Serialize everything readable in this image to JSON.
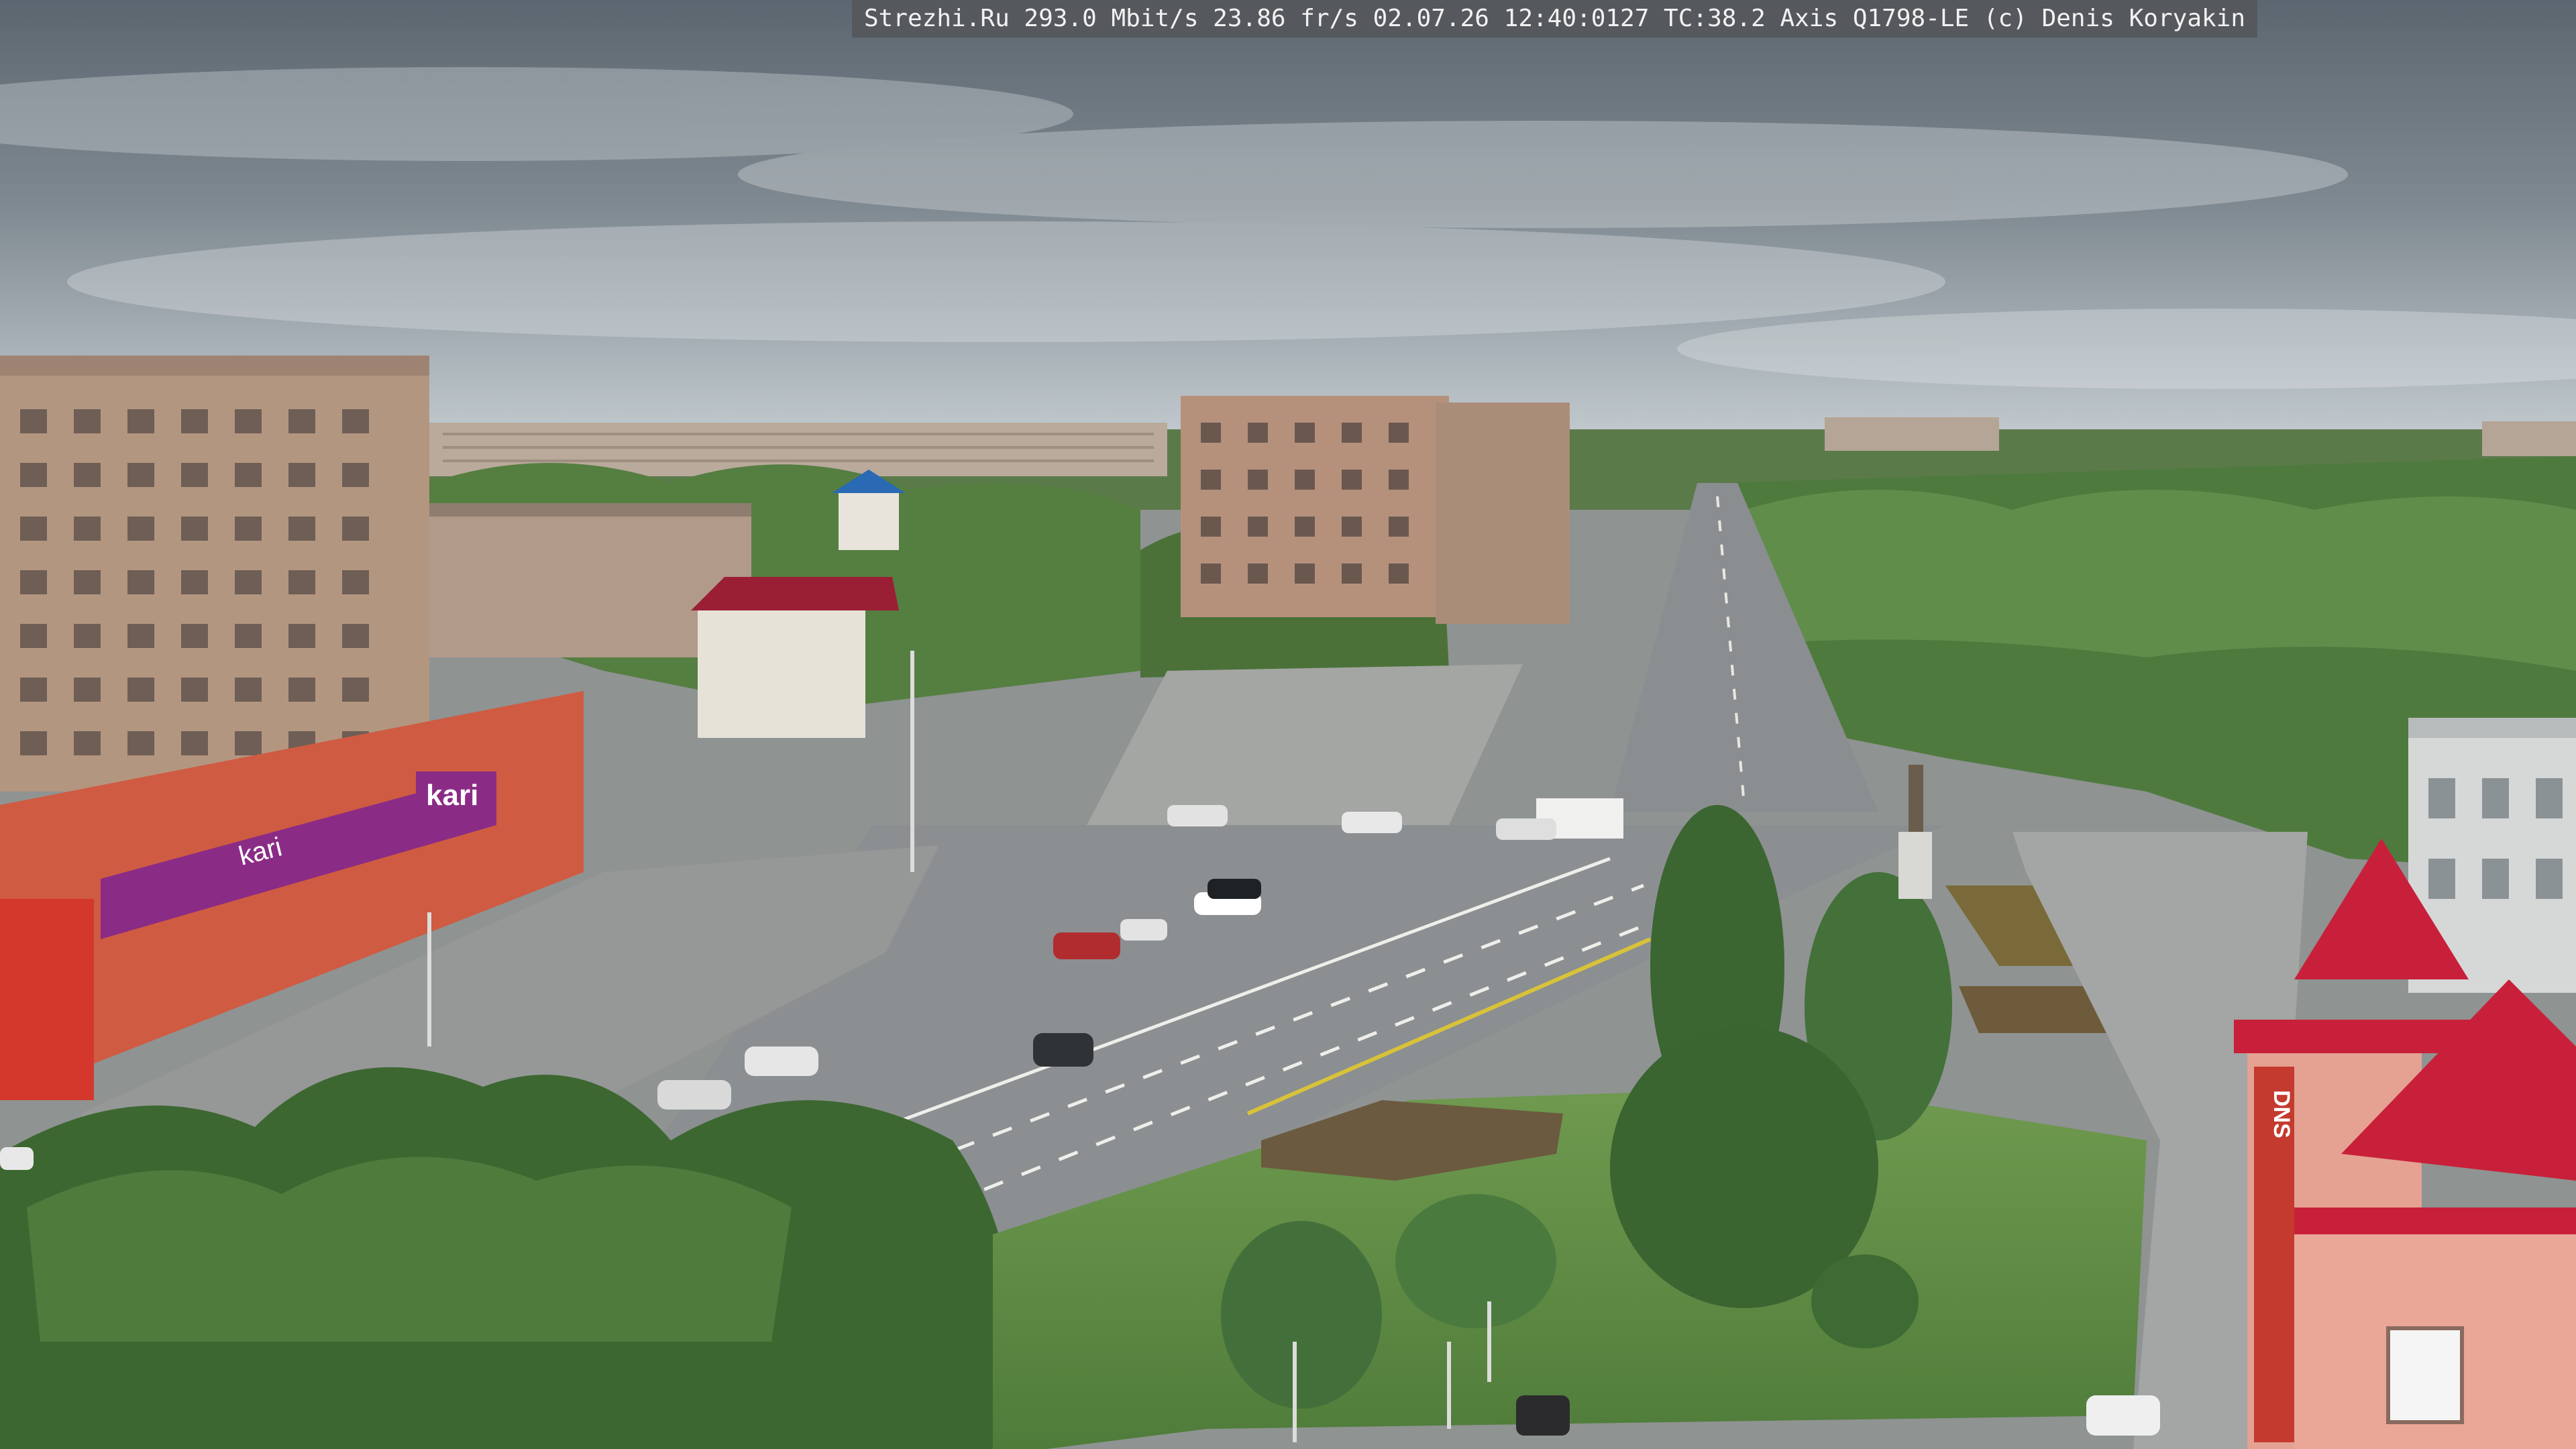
{
  "overlay": {
    "text": "Strezhi.Ru 293.0 Mbit/s 23.86 fr/s 02.07.26 12:40:0127 TC:38.2  Axis Q1798-LE  (c) Denis Koryakin"
  },
  "signs": {
    "kari_logo": "kari",
    "kari_banner": "kari",
    "dns_vertical": "DNS"
  },
  "colors": {
    "sky_top": "#5f6a73",
    "sky_bottom": "#c9d0d3",
    "tree_dark": "#3f6a35",
    "tree_light": "#6e9a55",
    "road": "#8d9192",
    "plaza": "#a7a8a5",
    "brick_building": "#b79a87",
    "red_store": "#d25a40",
    "kari_purple": "#8a2c86",
    "roof_red": "#c8203a"
  }
}
